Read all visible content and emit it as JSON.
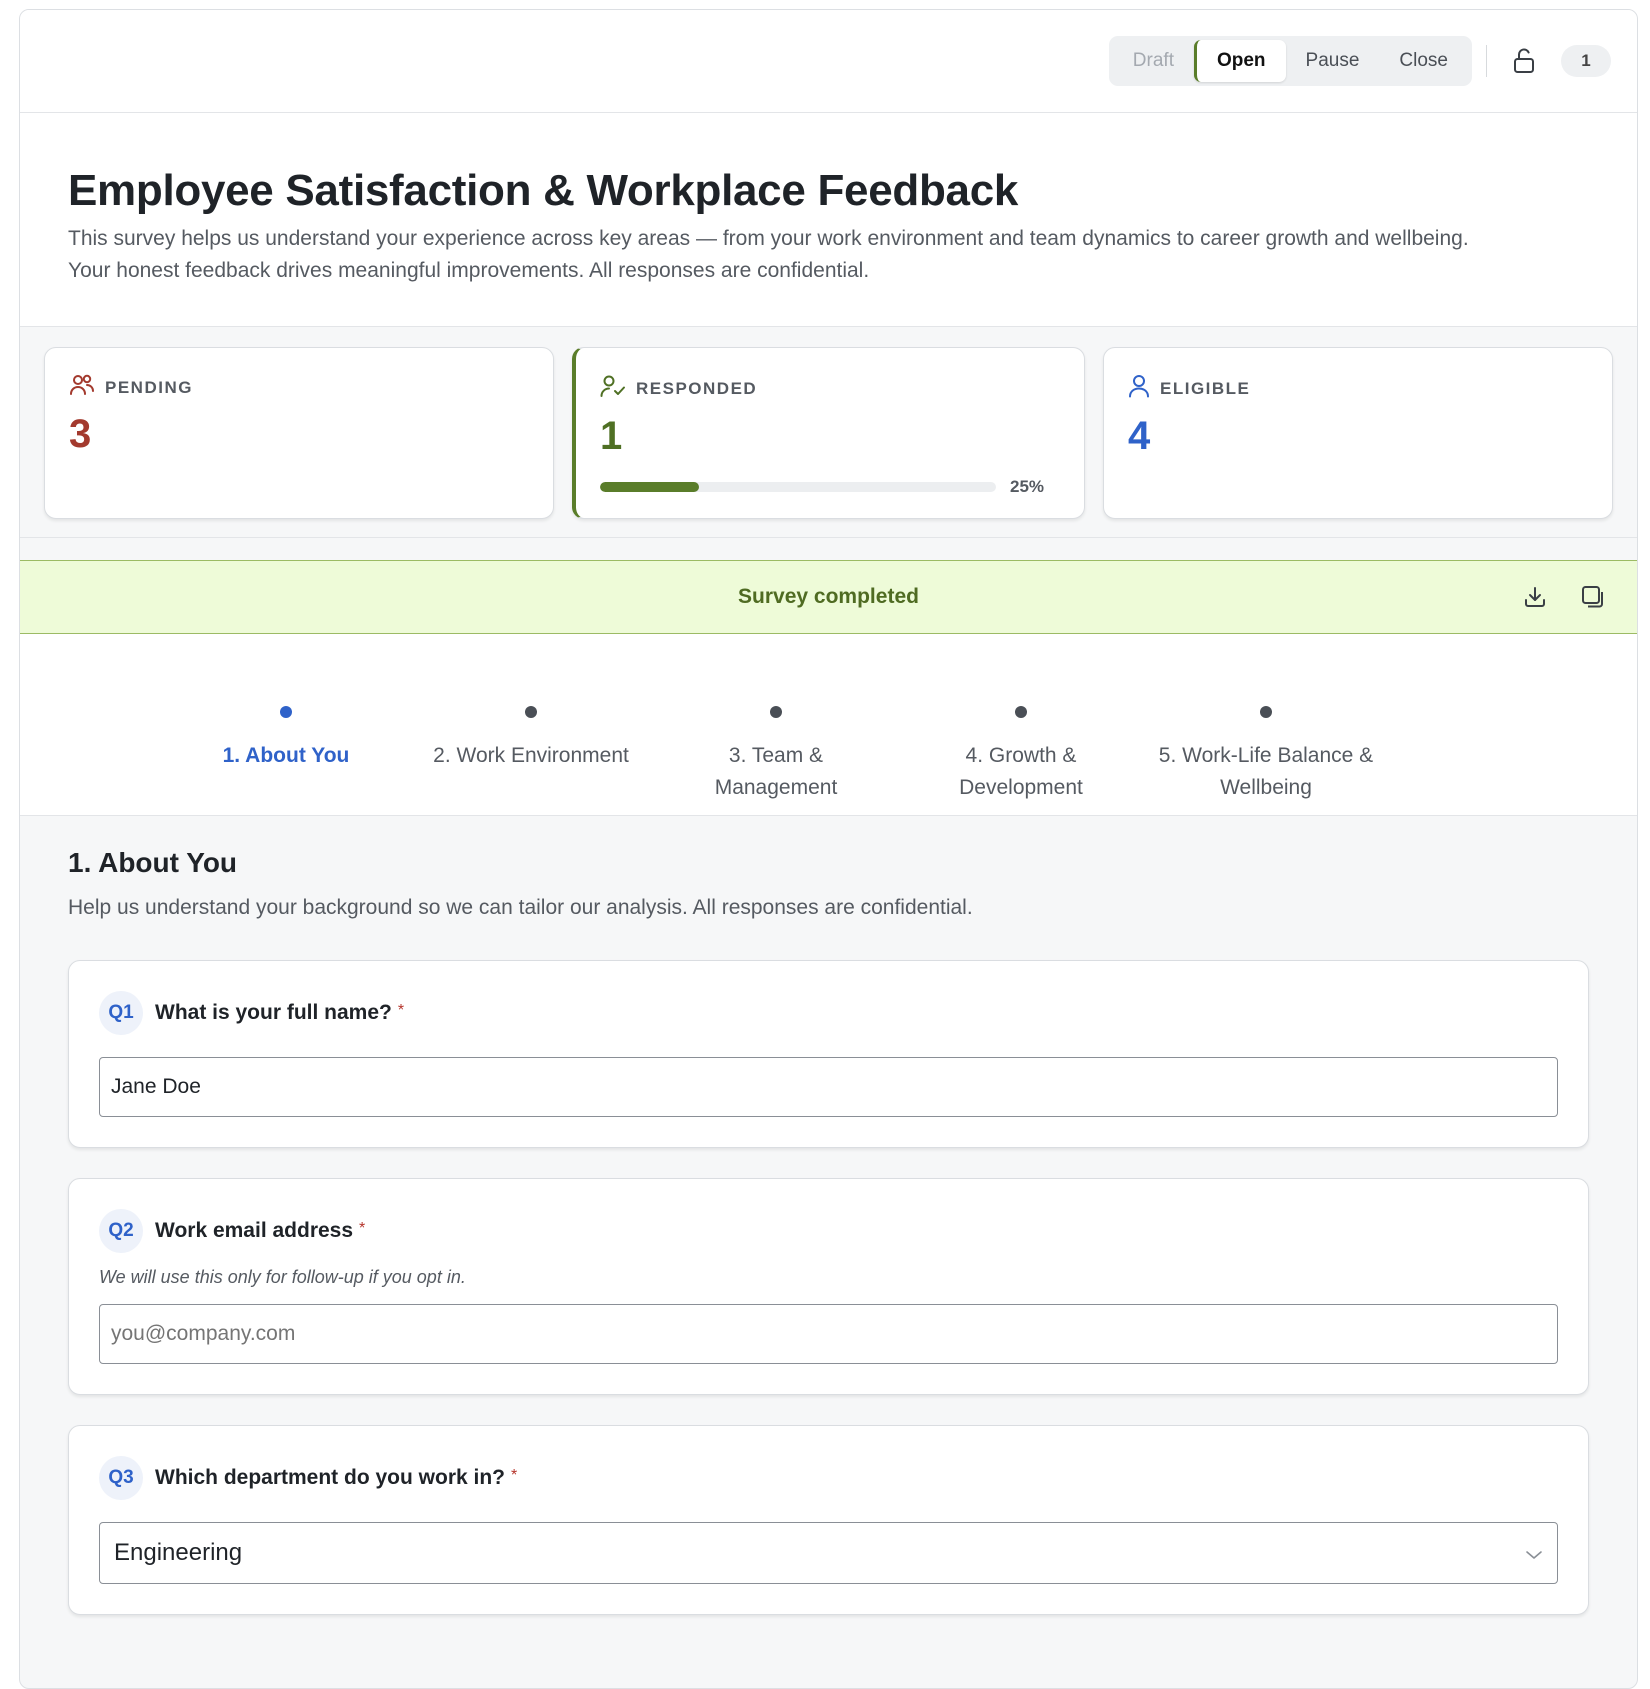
{
  "topbar": {
    "status_options": [
      {
        "label": "Draft",
        "state": "disabled"
      },
      {
        "label": "Open",
        "state": "active"
      },
      {
        "label": "Pause",
        "state": "normal"
      },
      {
        "label": "Close",
        "state": "normal"
      }
    ],
    "lock_icon": "unlock-icon",
    "count": "1"
  },
  "header": {
    "title": "Employee Satisfaction & Workplace Feedback",
    "description": "This survey helps us understand your experience across key areas — from your work environment and team dynamics to career growth and wellbeing. Your honest feedback drives meaningful improvements. All responses are confidential."
  },
  "stats": {
    "pending": {
      "label": "PENDING",
      "value": "3",
      "icon": "users-icon",
      "color": "#a33a2e"
    },
    "responded": {
      "label": "RESPONDED",
      "value": "1",
      "icon": "user-check-icon",
      "color": "#4f7024",
      "progress": 25,
      "progress_label": "25%"
    },
    "eligible": {
      "label": "ELIGIBLE",
      "value": "4",
      "icon": "user-icon",
      "color": "#2f62c9"
    }
  },
  "banner": {
    "text": "Survey completed",
    "actions": [
      "download-icon",
      "copy-icon"
    ],
    "color": "#eefbd8"
  },
  "steps": [
    {
      "label": "1. About You",
      "active": true
    },
    {
      "label": "2. Work Environment",
      "active": false
    },
    {
      "label": "3. Team & Management",
      "active": false
    },
    {
      "label": "4. Growth & Development",
      "active": false
    },
    {
      "label": "5. Work-Life Balance & Wellbeing",
      "active": false
    }
  ],
  "section": {
    "title": "1. About You",
    "description": "Help us understand your background so we can tailor our analysis. All responses are confidential.",
    "questions": [
      {
        "badge": "Q1",
        "title": "What is your full name?",
        "required": "*",
        "value": "Jane Doe"
      },
      {
        "badge": "Q2",
        "title": "Work email address",
        "required": "*",
        "hint": "We will use this only for follow-up if you opt in.",
        "placeholder": "you@company.com"
      },
      {
        "badge": "Q3",
        "title": "Which department do you work in?",
        "required": "*",
        "selected": "Engineering"
      }
    ]
  },
  "colors": {
    "accent_green": "#5a7d2a",
    "accent_blue": "#2f62c9",
    "danger": "#a33a2e"
  }
}
